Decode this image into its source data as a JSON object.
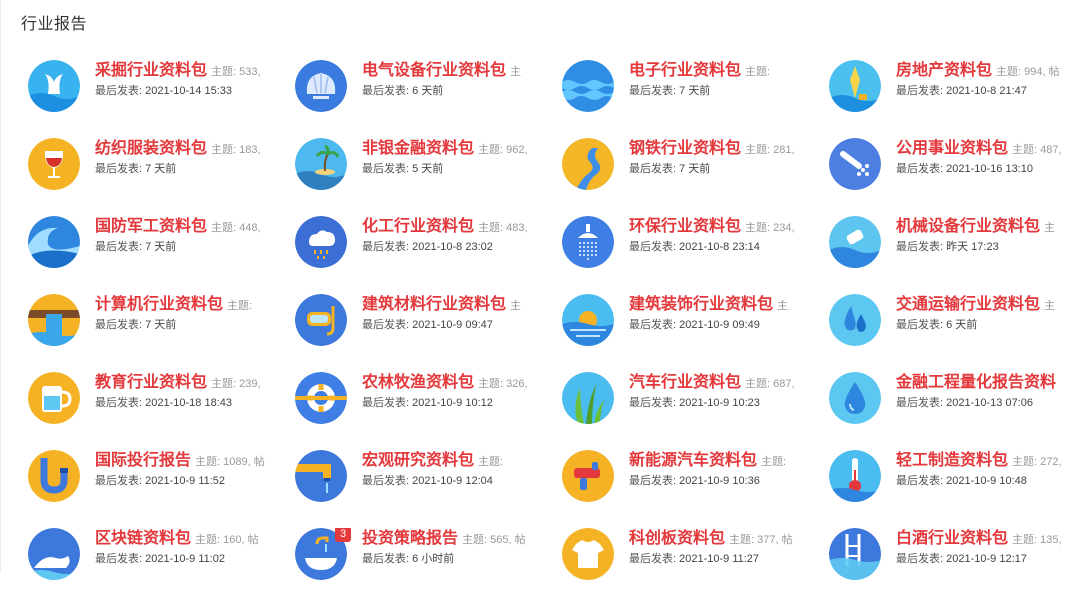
{
  "section_title": "行业报告",
  "forums": [
    {
      "name": "采掘行业资料包",
      "topics": "主题: 533,",
      "last_label": "最后发表:",
      "last_time": "2021-10-14 15:33",
      "icon": "whale-tail-icon",
      "colors": {
        "bg": "#39b3f0",
        "accent": "#ffffff"
      }
    },
    {
      "name": "电气设备行业资料包",
      "topics": "主",
      "last_label": "最后发表:",
      "last_time": "6 天前",
      "icon": "shell-icon",
      "colors": {
        "bg": "#3a7be0",
        "accent": "#dce9ff"
      }
    },
    {
      "name": "电子行业资料包",
      "topics": "主题:",
      "last_label": "最后发表:",
      "last_time": "7 天前",
      "icon": "waves-icon",
      "colors": {
        "bg": "#2f8de4",
        "accent": "#64c6ff"
      }
    },
    {
      "name": "房地产资料包",
      "topics": "主题: 994, 帖",
      "last_label": "最后发表:",
      "last_time": "2021-10-8 21:47",
      "icon": "surf-icon",
      "colors": {
        "bg": "#4bc0ef",
        "accent": "#f6d54b"
      }
    },
    {
      "name": "纺织服装资料包",
      "topics": "主题: 183,",
      "last_label": "最后发表:",
      "last_time": "7 天前",
      "icon": "wine-glass-icon",
      "colors": {
        "bg": "#f5b324",
        "accent": "#d6322a"
      }
    },
    {
      "name": "非银金融资料包",
      "topics": "主题: 962,",
      "last_label": "最后发表:",
      "last_time": "5 天前",
      "icon": "island-icon",
      "colors": {
        "bg": "#4db9ee",
        "accent": "#2f7fc1"
      }
    },
    {
      "name": "钢铁行业资料包",
      "topics": "主题: 281,",
      "last_label": "最后发表:",
      "last_time": "7 天前",
      "icon": "river-icon",
      "colors": {
        "bg": "#f4b527",
        "accent": "#3f8fe8"
      }
    },
    {
      "name": "公用事业资料包",
      "topics": "主题: 487,",
      "last_label": "最后发表:",
      "last_time": "2021-10-16 13:10",
      "icon": "shower-icon",
      "colors": {
        "bg": "#4d7fe3",
        "accent": "#ffffff"
      }
    },
    {
      "name": "国防军工资料包",
      "topics": "主题: 448,",
      "last_label": "最后发表:",
      "last_time": "7 天前",
      "icon": "big-wave-icon",
      "colors": {
        "bg": "#2f86de",
        "accent": "#9fdcff"
      }
    },
    {
      "name": "化工行业资料包",
      "topics": "主题: 483,",
      "last_label": "最后发表:",
      "last_time": "2021-10-8 23:02",
      "icon": "rain-cloud-icon",
      "colors": {
        "bg": "#3c6fd6",
        "accent": "#ffffff"
      }
    },
    {
      "name": "环保行业资料包",
      "topics": "主题: 234,",
      "last_label": "最后发表:",
      "last_time": "2021-10-8 23:14",
      "icon": "shower-head-icon",
      "colors": {
        "bg": "#3f7ee4",
        "accent": "#ffffff"
      }
    },
    {
      "name": "机械设备行业资料包",
      "topics": "主",
      "last_label": "最后发表:",
      "last_time": "昨天 17:23",
      "icon": "bottle-wave-icon",
      "colors": {
        "bg": "#5dc5ef",
        "accent": "#ffffff"
      }
    },
    {
      "name": "计算机行业资料包",
      "topics": "主题:",
      "last_label": "最后发表:",
      "last_time": "7 天前",
      "icon": "waterfall-icon",
      "colors": {
        "bg": "#f5b224",
        "accent": "#3aa7ec"
      }
    },
    {
      "name": "建筑材料行业资料包",
      "topics": "主",
      "last_label": "最后发表:",
      "last_time": "2021-10-9 09:47",
      "icon": "diving-mask-icon",
      "colors": {
        "bg": "#3d78dd",
        "accent": "#f3b423"
      }
    },
    {
      "name": "建筑装饰行业资料包",
      "topics": "主",
      "last_label": "最后发表:",
      "last_time": "2021-10-9 09:49",
      "icon": "sunset-sea-icon",
      "colors": {
        "bg": "#4bbcef",
        "accent": "#f5b224"
      }
    },
    {
      "name": "交通运输行业资料包",
      "topics": "主",
      "last_label": "最后发表:",
      "last_time": "6 天前",
      "icon": "water-drops-icon",
      "colors": {
        "bg": "#5cc7f0",
        "accent": "#2f86de"
      }
    },
    {
      "name": "教育行业资料包",
      "topics": "主题: 239,",
      "last_label": "最后发表:",
      "last_time": "2021-10-18 18:43",
      "icon": "water-cup-icon",
      "colors": {
        "bg": "#f5b224",
        "accent": "#5ec8f2"
      }
    },
    {
      "name": "农林牧渔资料包",
      "topics": "主题: 326,",
      "last_label": "最后发表:",
      "last_time": "2021-10-9 10:12",
      "icon": "life-ring-icon",
      "colors": {
        "bg": "#3f7ee4",
        "accent": "#f5b224"
      }
    },
    {
      "name": "汽车行业资料包",
      "topics": "主题: 687,",
      "last_label": "最后发表:",
      "last_time": "2021-10-9 10:23",
      "icon": "seaweed-icon",
      "colors": {
        "bg": "#4bbcef",
        "accent": "#6bbf3b"
      }
    },
    {
      "name": "金融工程量化报告资料",
      "topics": "",
      "last_label": "最后发表:",
      "last_time": "2021-10-13 07:06",
      "icon": "drop-icon",
      "colors": {
        "bg": "#5cc7f0",
        "accent": "#2f86de"
      }
    },
    {
      "name": "国际投行报告",
      "topics": "主题: 1089, 帖",
      "last_label": "最后发表:",
      "last_time": "2021-10-9 11:52",
      "icon": "pipe-icon",
      "colors": {
        "bg": "#f5b224",
        "accent": "#3d78dd"
      }
    },
    {
      "name": "宏观研究资料包",
      "topics": "主题:",
      "last_label": "最后发表:",
      "last_time": "2021-10-9 12:04",
      "icon": "faucet-icon",
      "colors": {
        "bg": "#3d78dd",
        "accent": "#f5b224"
      }
    },
    {
      "name": "新能源汽车资料包",
      "topics": "主题:",
      "last_label": "最后发表:",
      "last_time": "2021-10-9 10:36",
      "icon": "water-gun-icon",
      "colors": {
        "bg": "#f5b224",
        "accent": "#e4393c"
      }
    },
    {
      "name": "轻工制造资料包",
      "topics": "主题: 272,",
      "last_label": "最后发表:",
      "last_time": "2021-10-9 10:48",
      "icon": "thermometer-icon",
      "colors": {
        "bg": "#4bbcef",
        "accent": "#e4393c"
      }
    },
    {
      "name": "区块链资料包",
      "topics": "主题: 160, 帖",
      "last_label": "最后发表:",
      "last_time": "2021-10-9 11:02",
      "icon": "washing-hands-icon",
      "colors": {
        "bg": "#3d78dd",
        "accent": "#ffffff"
      }
    },
    {
      "name": "投资策略报告",
      "topics": "主题: 565, 帖",
      "last_label": "最后发表:",
      "last_time": "6 小时前",
      "icon": "sink-icon",
      "colors": {
        "bg": "#3d78dd",
        "accent": "#f5b224"
      },
      "badge": "3"
    },
    {
      "name": "科创板资料包",
      "topics": "主题: 377, 帖",
      "last_label": "最后发表:",
      "last_time": "2021-10-9 11:27",
      "icon": "tshirt-icon",
      "colors": {
        "bg": "#f5b224",
        "accent": "#ffffff"
      }
    },
    {
      "name": "白酒行业资料包",
      "topics": "主题: 135,",
      "last_label": "最后发表:",
      "last_time": "2021-10-9 12:17",
      "icon": "pool-ladder-icon",
      "colors": {
        "bg": "#3d78dd",
        "accent": "#5ec8f2"
      }
    }
  ]
}
